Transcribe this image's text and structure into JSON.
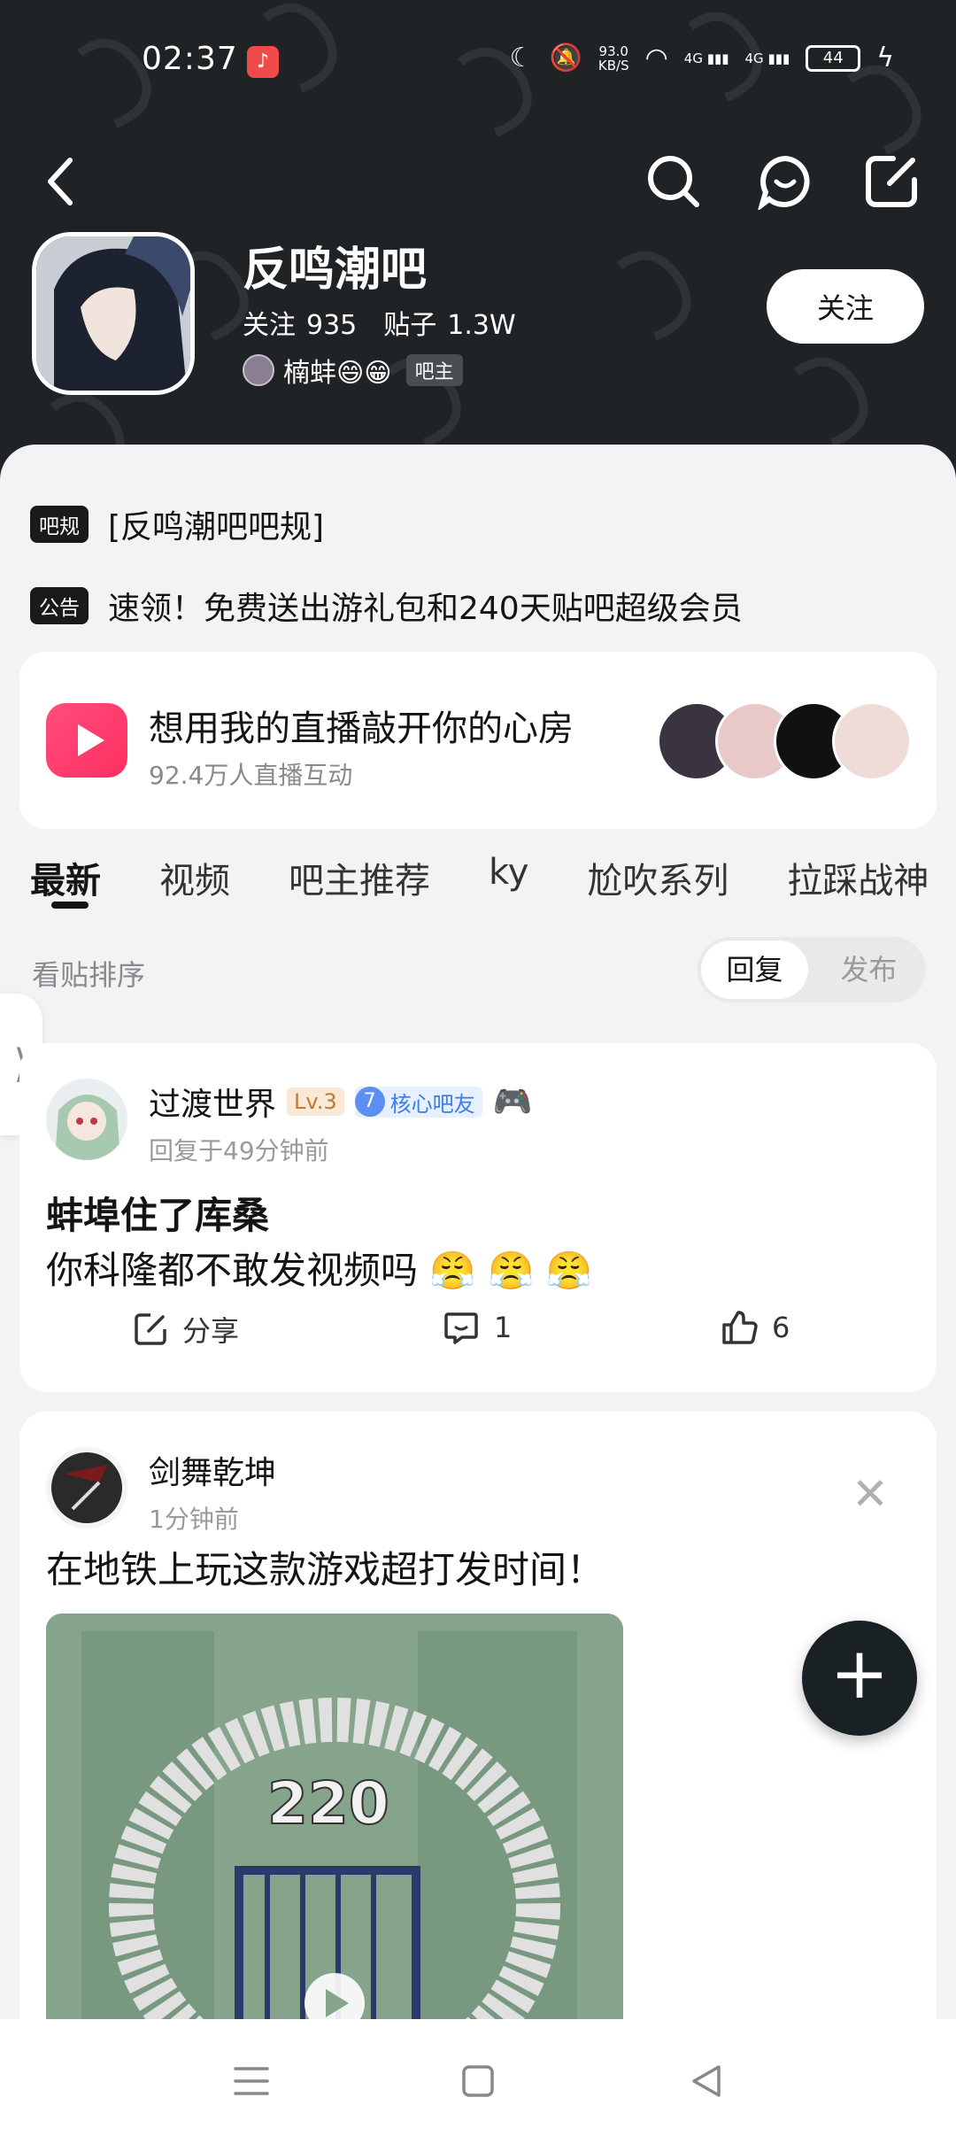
{
  "status_bar": {
    "time": "02:37",
    "net_speed": "93.0",
    "net_unit": "KB/S",
    "signal1": "4G",
    "signal2": "4G",
    "battery": "44"
  },
  "forum": {
    "name": "反鸣潮吧",
    "follow_label": "关注",
    "follow_count": "935",
    "posts_label": "贴子",
    "posts_count": "1.3W",
    "owner_name": "楠蚌😄😁",
    "owner_badge": "吧主",
    "follow_button": "关注"
  },
  "notices": [
    {
      "tag": "吧规",
      "text": "[反鸣潮吧吧规]"
    },
    {
      "tag": "公告",
      "text": "速领！免费送出游礼包和240天贴吧超级会员"
    }
  ],
  "live": {
    "title": "想用我的直播敲开你的心房",
    "subtitle": "92.4万人直播互动"
  },
  "tabs": [
    "最新",
    "视频",
    "吧主推荐",
    "ky",
    "尬吹系列",
    "拉踩战神"
  ],
  "sort": {
    "label": "看贴排序",
    "options": [
      "回复",
      "发布"
    ]
  },
  "posts": [
    {
      "user": "过渡世界",
      "level": "Lv.3",
      "core_level": "7",
      "core_label": "核心吧友",
      "time": "回复于49分钟前",
      "title": "蚌埠住了库桑",
      "body": "你科隆都不敢发视频吗 😤 😤 😤",
      "share": "分享",
      "comments": "1",
      "likes": "6"
    },
    {
      "user": "剑舞乾坤",
      "time": "1分钟前",
      "title": "在地铁上玩这款游戏超打发时间！",
      "video_overlay": "220"
    }
  ],
  "colors": {
    "header_bg": "#1f2326",
    "accent_live": "#ff2e63",
    "fab_bg": "#1a2124"
  }
}
